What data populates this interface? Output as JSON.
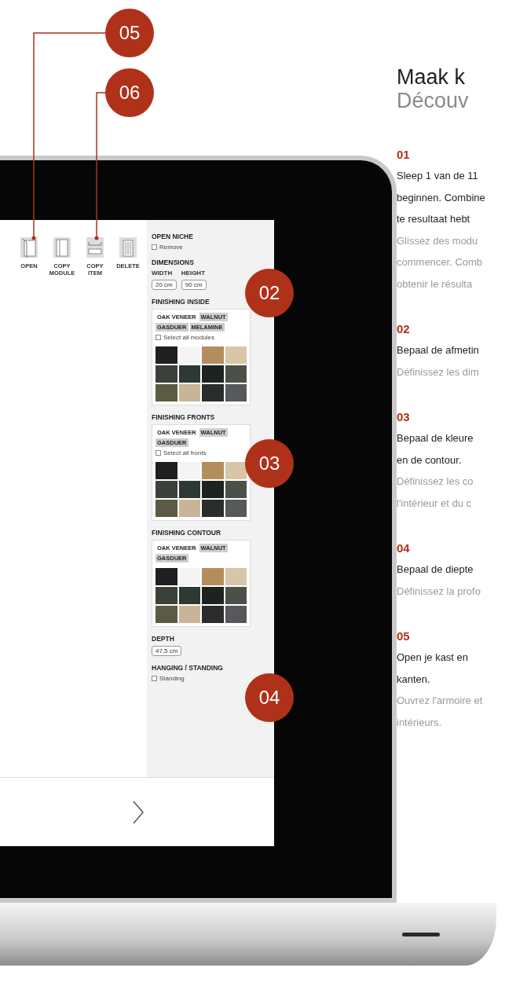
{
  "callouts": [
    {
      "label": "05",
      "kind": "leader"
    },
    {
      "label": "06",
      "kind": "leader"
    },
    {
      "label": "02",
      "kind": "badge"
    },
    {
      "label": "03",
      "kind": "badge"
    },
    {
      "label": "04",
      "kind": "badge"
    }
  ],
  "app": {
    "toolbar": [
      {
        "label": "OPEN"
      },
      {
        "label": "COPY MODULE"
      },
      {
        "label": "COPY ITEM"
      },
      {
        "label": "DELETE"
      }
    ],
    "panel": [
      {
        "kind": "checkbox",
        "title": "OPEN NICHE",
        "option": "Remove",
        "checked": false
      },
      {
        "kind": "dimensions",
        "title": "DIMENSIONS",
        "fields": [
          {
            "label": "WIDTH",
            "value": "20 cm"
          },
          {
            "label": "HEIGHT",
            "value": "90 cm"
          }
        ]
      },
      {
        "kind": "finish",
        "title": "FINISHING INSIDE",
        "tabs": [
          {
            "label": "OAK VENEER",
            "selected": true
          },
          {
            "label": "WALNUT",
            "selected": false
          },
          {
            "label": "GASDUER",
            "selected": false
          },
          {
            "label": "MELAMINE",
            "selected": false
          }
        ],
        "option": "Select all modules",
        "checked": false,
        "swatches": [
          {
            "color": "#1f1f1f"
          },
          {
            "color": "#f4f4f4"
          },
          {
            "color": "#b48d5c"
          },
          {
            "color": "#d8c6a6"
          },
          {
            "color": "#3b4039"
          },
          {
            "color": "#2d3933"
          },
          {
            "color": "#1c2320"
          },
          {
            "color": "#4b5149"
          },
          {
            "color": "#5c5a44"
          },
          {
            "color": "#c8b597"
          },
          {
            "color": "#2a2d2b"
          },
          {
            "color": "#56585b"
          }
        ]
      },
      {
        "kind": "finish",
        "title": "FINISHING FRONTS",
        "tabs": [
          {
            "label": "OAK VENEER",
            "selected": true
          },
          {
            "label": "WALNUT",
            "selected": false
          },
          {
            "label": "GASDUER",
            "selected": false
          }
        ],
        "option": "Select all fronts",
        "checked": false,
        "swatches": [
          {
            "color": "#1f1f1f"
          },
          {
            "color": "#f4f4f4"
          },
          {
            "color": "#b48d5c"
          },
          {
            "color": "#d8c6a6"
          },
          {
            "color": "#3b4039"
          },
          {
            "color": "#2d3933"
          },
          {
            "color": "#1c2320"
          },
          {
            "color": "#4b5149"
          },
          {
            "color": "#5c5a44"
          },
          {
            "color": "#c8b597"
          },
          {
            "color": "#2a2d2b"
          },
          {
            "color": "#56585b"
          }
        ]
      },
      {
        "kind": "finish",
        "title": "FINISHING CONTOUR",
        "tabs": [
          {
            "label": "OAK VENEER",
            "selected": true
          },
          {
            "label": "WALNUT",
            "selected": false
          },
          {
            "label": "GASDUER",
            "selected": false
          }
        ],
        "swatches": [
          {
            "color": "#1f1f1f"
          },
          {
            "color": "#f4f4f4"
          },
          {
            "color": "#b48d5c"
          },
          {
            "color": "#d8c6a6"
          },
          {
            "color": "#3b4039"
          },
          {
            "color": "#2d3933"
          },
          {
            "color": "#1c2320"
          },
          {
            "color": "#4b5149"
          },
          {
            "color": "#5c5a44"
          },
          {
            "color": "#c8b597"
          },
          {
            "color": "#2a2d2b"
          },
          {
            "color": "#56585b"
          }
        ]
      },
      {
        "kind": "depth",
        "title": "DEPTH",
        "value": "47,5 cm"
      },
      {
        "kind": "checkbox",
        "title": "HANGING / STANDING",
        "option": "Standing",
        "checked": false
      }
    ]
  },
  "heading": {
    "title": "Maak k",
    "subtitle": "Découv"
  },
  "steps": [
    {
      "number": "01",
      "nl": [
        "Sleep 1 van de 11",
        "beginnen. Combine",
        "te resultaat hebt"
      ],
      "fr": [
        "Glissez des modu",
        "commencer. Comb",
        "obtenir le résulta"
      ]
    },
    {
      "number": "02",
      "nl": [
        "Bepaal de afmetin"
      ],
      "fr": [
        "Définissez les dim"
      ]
    },
    {
      "number": "03",
      "nl": [
        "Bepaal de kleure",
        "en de contour."
      ],
      "fr": [
        "Définissez les co",
        "l'intérieur et du c"
      ]
    },
    {
      "number": "04",
      "nl": [
        "Bepaal de diepte"
      ],
      "fr": [
        "Définissez la profo"
      ]
    },
    {
      "number": "05",
      "nl": [
        "Open je kast en",
        "kanten."
      ],
      "fr": [
        "Ouvrez l'armoire et",
        "intérieurs."
      ]
    }
  ]
}
